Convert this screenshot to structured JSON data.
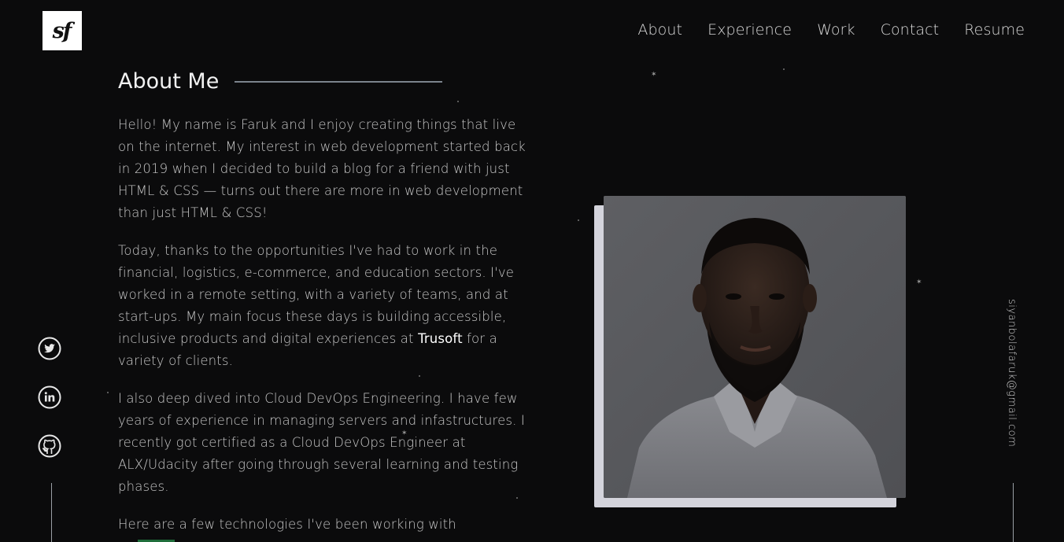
{
  "logo": {
    "text": "sf"
  },
  "nav": {
    "items": [
      {
        "label": "About"
      },
      {
        "label": "Experience"
      },
      {
        "label": "Work"
      },
      {
        "label": "Contact"
      },
      {
        "label": "Resume"
      }
    ]
  },
  "about": {
    "title": "About Me",
    "p1": "Hello! My name is Faruk and I enjoy creating things that live on the internet. My interest in web development started back in 2019 when I decided to build a blog for a friend with just HTML & CSS — turns out there are more in web development than just HTML & CSS!",
    "p2_before": "Today, thanks to the opportunities I've had to work in the financial, logistics, e-commerce, and education sectors. I've worked in a remote setting, with a variety of teams, and at start-ups. My main focus these days is building accessible, inclusive products and digital experiences at ",
    "p2_highlight": "Trusoft",
    "p2_after": " for a variety of clients.",
    "p3": "I also deep dived into Cloud DevOps Engineering. I have few years of experience in managing servers and infastructures. I recently got certified as a Cloud DevOps Engineer at ALX/Udacity after going through several learning and testing phases.",
    "p4": "Here are a few technologies I've been working with"
  },
  "social": {
    "icons": [
      "twitter-icon",
      "linkedin-icon",
      "github-icon"
    ]
  },
  "email": "siyanbolafaruk@gmail.com",
  "colors": {
    "background": "#0b0b0c",
    "text": "#c9c9c9",
    "heading": "#f2f2f2",
    "rule": "#7b838c",
    "photo_back": "#d4d4dc",
    "accent": "#1f6d3a"
  }
}
